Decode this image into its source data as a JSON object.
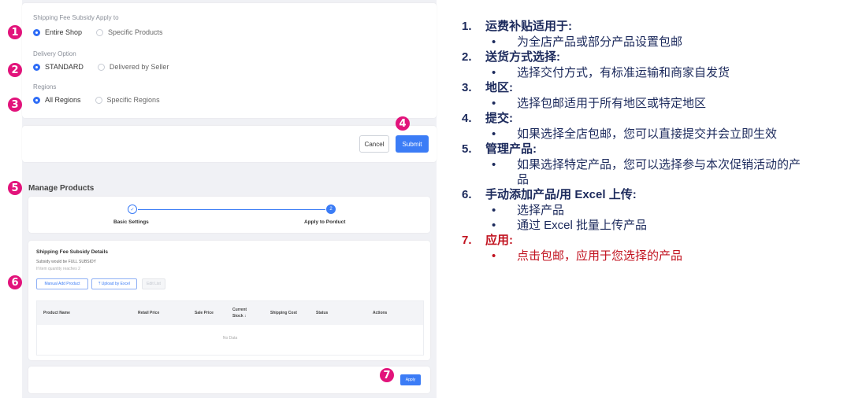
{
  "settings": {
    "subsidy_label": "Shipping Fee Subsidy Apply to",
    "subsidy_options": [
      "Entire Shop",
      "Specific Products"
    ],
    "delivery_label": "Delivery Option",
    "delivery_options": [
      "STANDARD",
      "Delivered by Seller"
    ],
    "regions_label": "Regions",
    "regions_options": [
      "All Regions",
      "Specific Regions"
    ]
  },
  "actions": {
    "cancel": "Cancel",
    "submit": "Submit"
  },
  "manage": {
    "title": "Manage Products",
    "steps": [
      {
        "label": "Basic Settings",
        "mark": "✓"
      },
      {
        "label": "Apply to Porduct",
        "mark": "2"
      }
    ],
    "details_title": "Shipping Fee Subsidy Details",
    "details_sub1": "Subsidy would be FULL SUBSIDY",
    "details_sub2": "If item quantity reaches 2",
    "buttons": [
      "Manual Add Product",
      "⤒ Upload by Excel",
      "Edit List"
    ],
    "columns": [
      "Product Name",
      "Retail Price",
      "Sale Price",
      "Current Stock ↕",
      "Shipping Cost",
      "Status",
      "Actions"
    ],
    "no_data": "No Data",
    "apply": "Apply"
  },
  "badges": [
    "1",
    "2",
    "3",
    "4",
    "5",
    "6",
    "7"
  ],
  "colors": {
    "primary": "#3b7cf6",
    "badge": "#e2137b",
    "note_text": "#1c2a5c",
    "note_highlight": "#c1121f"
  },
  "notes": [
    {
      "num": "1.",
      "title": "运费补贴适用于:",
      "bullets": [
        "为全店产品或部分产品设置包邮"
      ]
    },
    {
      "num": "2.",
      "title": "送货方式选择:",
      "bullets": [
        "选择交付方式，有标准运输和商家自发货"
      ]
    },
    {
      "num": "3.",
      "title": "地区:",
      "bullets": [
        "选择包邮适用于所有地区或特定地区"
      ]
    },
    {
      "num": "4.",
      "title": "提交:",
      "bullets": [
        "如果选择全店包邮，您可以直接提交并会立即生效"
      ]
    },
    {
      "num": "5.",
      "title": "管理产品:",
      "bullets": [
        "如果选择特定产品，您可以选择参与本次促销活动的产品"
      ]
    },
    {
      "num": "6.",
      "title": "手动添加产品/用 Excel 上传:",
      "bullets": [
        "选择产品",
        "通过 Excel 批量上传产品"
      ]
    },
    {
      "num": "7.",
      "title": "应用:",
      "bullets": [
        "点击包邮，应用于您选择的产品"
      ]
    }
  ]
}
